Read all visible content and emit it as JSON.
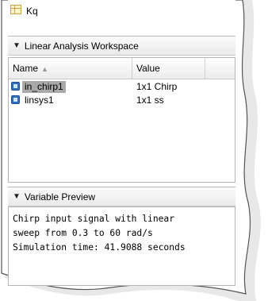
{
  "top_item": {
    "label": "Kq",
    "icon": "table-icon"
  },
  "workspace": {
    "title": "Linear Analysis Workspace",
    "columns": {
      "name": "Name",
      "value": "Value"
    },
    "sort_indicator": "▲",
    "rows": [
      {
        "name": "in_chirp1",
        "value": "1x1 Chirp",
        "icon": "variable-icon",
        "selected": true
      },
      {
        "name": "linsys1",
        "value": "1x1 ss",
        "icon": "variable-icon",
        "selected": false
      }
    ]
  },
  "preview": {
    "title": "Variable Preview",
    "lines": [
      "Chirp input signal with linear",
      "sweep from 0.3 to 60 rad/s",
      "Simulation time: 41.9088 seconds"
    ]
  },
  "colors": {
    "selection": "#a9a9a9",
    "variable_icon": "#2f6fc0",
    "border": "#b5b5b5"
  }
}
